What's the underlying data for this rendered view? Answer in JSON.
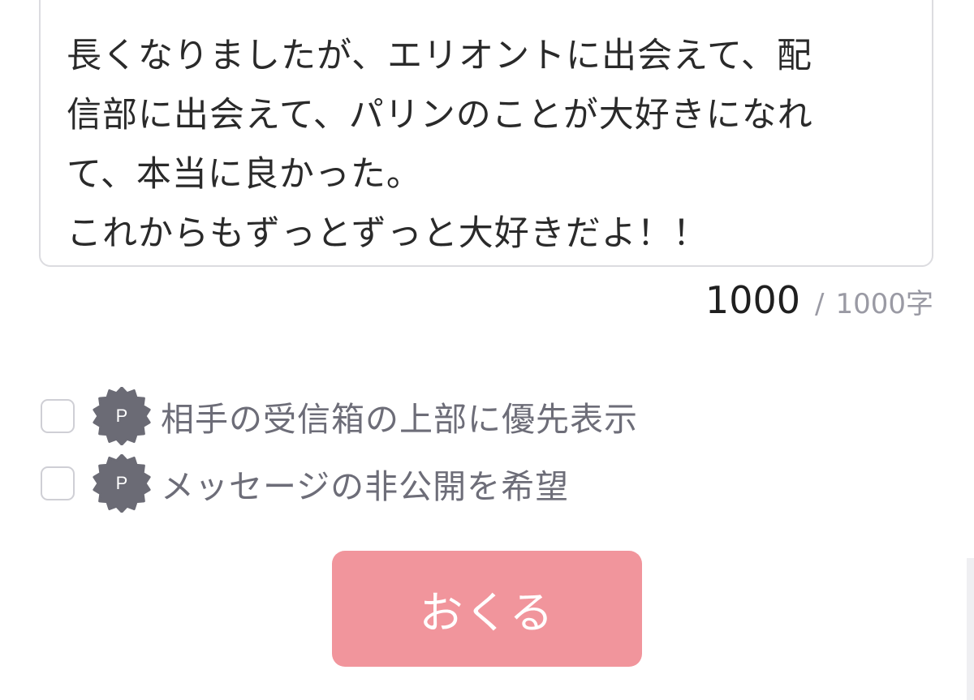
{
  "message": {
    "lines": [
      "長くなりましたが、エリオントに出会えて、配",
      "信部に出会えて、パリンのことが大好きになれ",
      "て、本当に良かった。",
      "これからもずっとずっと大好きだよ！！"
    ]
  },
  "counter": {
    "current": "1000",
    "separator": "/",
    "max": "1000字"
  },
  "options": [
    {
      "badge": "P",
      "label": "相手の受信箱の上部に優先表示",
      "checked": false
    },
    {
      "badge": "P",
      "label": "メッセージの非公開を希望",
      "checked": false
    }
  ],
  "submit": {
    "label": "おくる"
  },
  "colors": {
    "accent": "#f1959c",
    "badge": "#6b6b75",
    "border": "#dcdce0",
    "option_text": "#6d6d78"
  }
}
